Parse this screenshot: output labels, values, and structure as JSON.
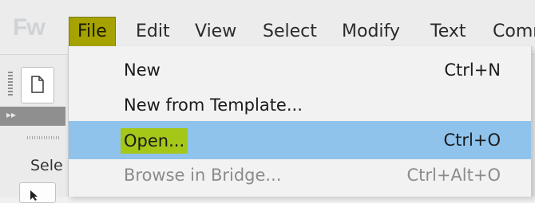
{
  "app": {
    "logo": "Fw"
  },
  "menubar": {
    "items": [
      {
        "label": "File",
        "active": true
      },
      {
        "label": "Edit"
      },
      {
        "label": "View"
      },
      {
        "label": "Select"
      },
      {
        "label": "Modify"
      },
      {
        "label": "Text"
      },
      {
        "label": "Comm"
      }
    ]
  },
  "file_menu": {
    "items": [
      {
        "label": "New",
        "shortcut": "Ctrl+N",
        "enabled": true
      },
      {
        "label": "New from Template...",
        "shortcut": "",
        "enabled": true
      },
      {
        "label": "Open...",
        "shortcut": "Ctrl+O",
        "enabled": true,
        "highlighted": true
      },
      {
        "label": "Browse in Bridge...",
        "shortcut": "Ctrl+Alt+O",
        "enabled": false
      }
    ]
  },
  "tools_panel": {
    "select_label": "Sele"
  },
  "colors": {
    "menu_highlight": "#a6a300",
    "item_highlight": "#8fc3ec",
    "label_highlight": "#a5c718"
  }
}
